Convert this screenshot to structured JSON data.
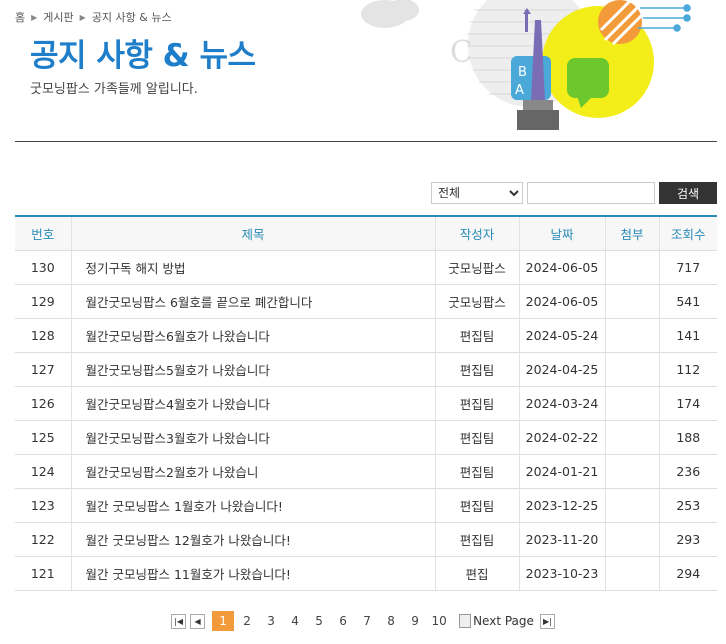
{
  "breadcrumb": [
    "홈",
    "게시판",
    "공지 사항 & 뉴스"
  ],
  "page_title": "공지 사항 & 뉴스",
  "subtitle": "굿모닝팝스 가족들께 알립니다.",
  "search": {
    "selected": "전체",
    "button": "검색"
  },
  "table": {
    "headers": [
      "번호",
      "제목",
      "작성자",
      "날짜",
      "첨부",
      "조회수"
    ],
    "rows": [
      {
        "num": "130",
        "title": "정기구독 해지 방법",
        "author": "굿모닝팝스",
        "date": "2024-06-05",
        "attach": "",
        "views": "717"
      },
      {
        "num": "129",
        "title": "월간굿모닝팝스 6월호를 끝으로 폐간합니다",
        "author": "굿모닝팝스",
        "date": "2024-06-05",
        "attach": "",
        "views": "541"
      },
      {
        "num": "128",
        "title": "월간굿모닝팝스6월호가 나왔습니다",
        "author": "편집팀",
        "date": "2024-05-24",
        "attach": "",
        "views": "141"
      },
      {
        "num": "127",
        "title": "월간굿모닝팝스5월호가 나왔습니다",
        "author": "편집팀",
        "date": "2024-04-25",
        "attach": "",
        "views": "112"
      },
      {
        "num": "126",
        "title": "월간굿모닝팝스4월호가 나왔습니다",
        "author": "편집팀",
        "date": "2024-03-24",
        "attach": "",
        "views": "174"
      },
      {
        "num": "125",
        "title": "월간굿모닝팝스3월호가 나왔습니다",
        "author": "편집팀",
        "date": "2024-02-22",
        "attach": "",
        "views": "188"
      },
      {
        "num": "124",
        "title": "월간굿모닝팝스2월호가 나왔습니",
        "author": "편집팀",
        "date": "2024-01-21",
        "attach": "",
        "views": "236"
      },
      {
        "num": "123",
        "title": "월간 굿모닝팝스 1월호가 나왔습니다!",
        "author": "편집팀",
        "date": "2023-12-25",
        "attach": "",
        "views": "253"
      },
      {
        "num": "122",
        "title": "월간 굿모닝팝스 12월호가 나왔습니다!",
        "author": "편집팀",
        "date": "2023-11-20",
        "attach": "",
        "views": "293"
      },
      {
        "num": "121",
        "title": "월간 굿모닝팝스 11월호가 나왔습니다!",
        "author": "편집",
        "date": "2023-10-23",
        "attach": "",
        "views": "294"
      }
    ]
  },
  "pagination": {
    "pages": [
      "1",
      "2",
      "3",
      "4",
      "5",
      "6",
      "7",
      "8",
      "9",
      "10"
    ],
    "current": "1",
    "next_alt": "Next Page"
  },
  "colors": {
    "title_blue": "#1f7ec9",
    "header_blue": "#2a8bb6",
    "active_page": "#f39a3b"
  }
}
